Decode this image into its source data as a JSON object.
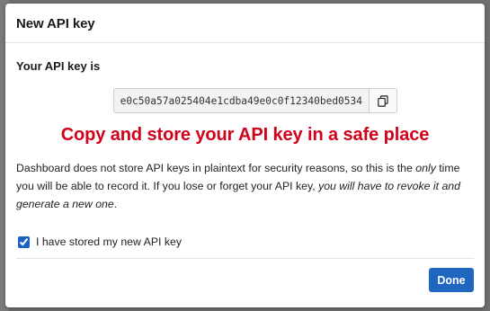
{
  "dialog": {
    "title": "New API key"
  },
  "api_key": {
    "label": "Your API key is",
    "value": "e0c50a57a025404e1cdba49e0c0f12340bed0534",
    "copy_icon": "copy-icon"
  },
  "warning": {
    "text": "Copy and store your API key in a safe place",
    "color": "#d0021b"
  },
  "description": {
    "part1": "Dashboard does not store API keys in plaintext for security reasons, so this is the ",
    "part2_em": "only",
    "part3": " time you will be able to record it. If you lose or forget your API key, ",
    "part4_em": "you will have to revoke it and generate a new one",
    "part5": "."
  },
  "confirm": {
    "label": "I have stored my new API key",
    "checked": true
  },
  "footer": {
    "done_label": "Done",
    "accent": "#1f66c1"
  }
}
